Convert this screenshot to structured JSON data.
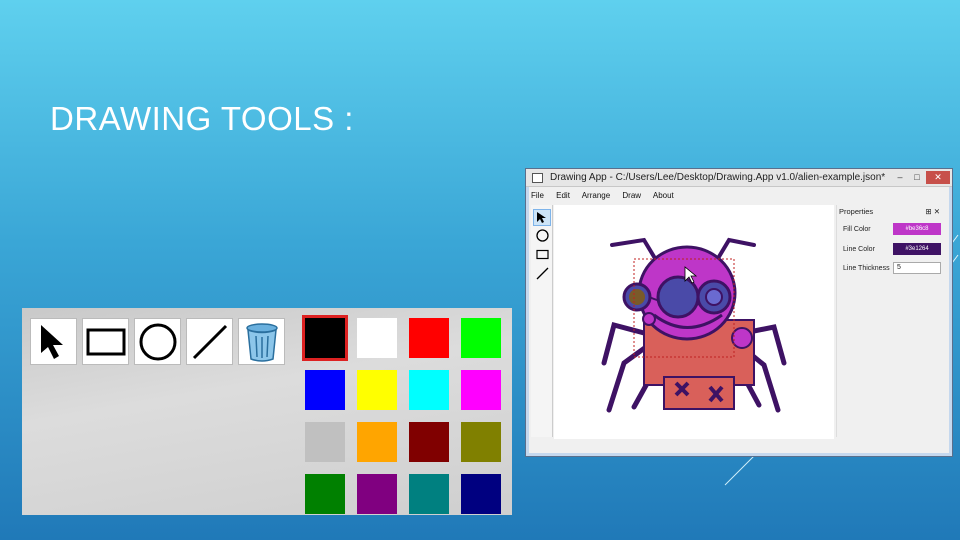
{
  "slide": {
    "title": "DRAWING TOOLS :"
  },
  "palette": {
    "tools": [
      {
        "icon": "pointer-arrow-icon"
      },
      {
        "icon": "rectangle-icon"
      },
      {
        "icon": "circle-icon"
      },
      {
        "icon": "line-icon"
      },
      {
        "icon": "trash-bin-icon"
      }
    ],
    "colors": [
      {
        "name": "black",
        "hex": "#000000",
        "selected": true
      },
      {
        "name": "white",
        "hex": "#ffffff"
      },
      {
        "name": "red",
        "hex": "#ff0000"
      },
      {
        "name": "lime",
        "hex": "#00ff00"
      },
      {
        "name": "blue",
        "hex": "#0000ff"
      },
      {
        "name": "yellow",
        "hex": "#ffff00"
      },
      {
        "name": "cyan",
        "hex": "#00ffff"
      },
      {
        "name": "magenta",
        "hex": "#ff00ff"
      },
      {
        "name": "silver",
        "hex": "#c0c0c0"
      },
      {
        "name": "orange",
        "hex": "#ffa500"
      },
      {
        "name": "maroon",
        "hex": "#800000"
      },
      {
        "name": "olive",
        "hex": "#808000"
      },
      {
        "name": "green",
        "hex": "#008000"
      },
      {
        "name": "purple",
        "hex": "#800080"
      },
      {
        "name": "teal",
        "hex": "#008080"
      },
      {
        "name": "navy",
        "hex": "#000080"
      }
    ]
  },
  "app": {
    "title": "Drawing App - C:/Users/Lee/Desktop/Drawing.App v1.0/alien-example.json*",
    "window_buttons": [
      "–",
      "□",
      "✕"
    ],
    "menu": [
      "File",
      "Edit",
      "Arrange",
      "Draw",
      "About"
    ],
    "toolstrip": [
      "pointer-icon",
      "circle-tool-icon",
      "rectangle-tool-icon",
      "line-tool-icon"
    ],
    "properties": {
      "header": "Properties",
      "pin": "⊞ ✕",
      "fill_label": "Fill Color",
      "fill_value": "#be36c8",
      "fill_color": "#be36c8",
      "line_label": "Line Color",
      "line_value": "#3e1264",
      "line_color": "#3e1264",
      "thickness_label": "Line Thickness",
      "thickness_value": "5"
    }
  }
}
